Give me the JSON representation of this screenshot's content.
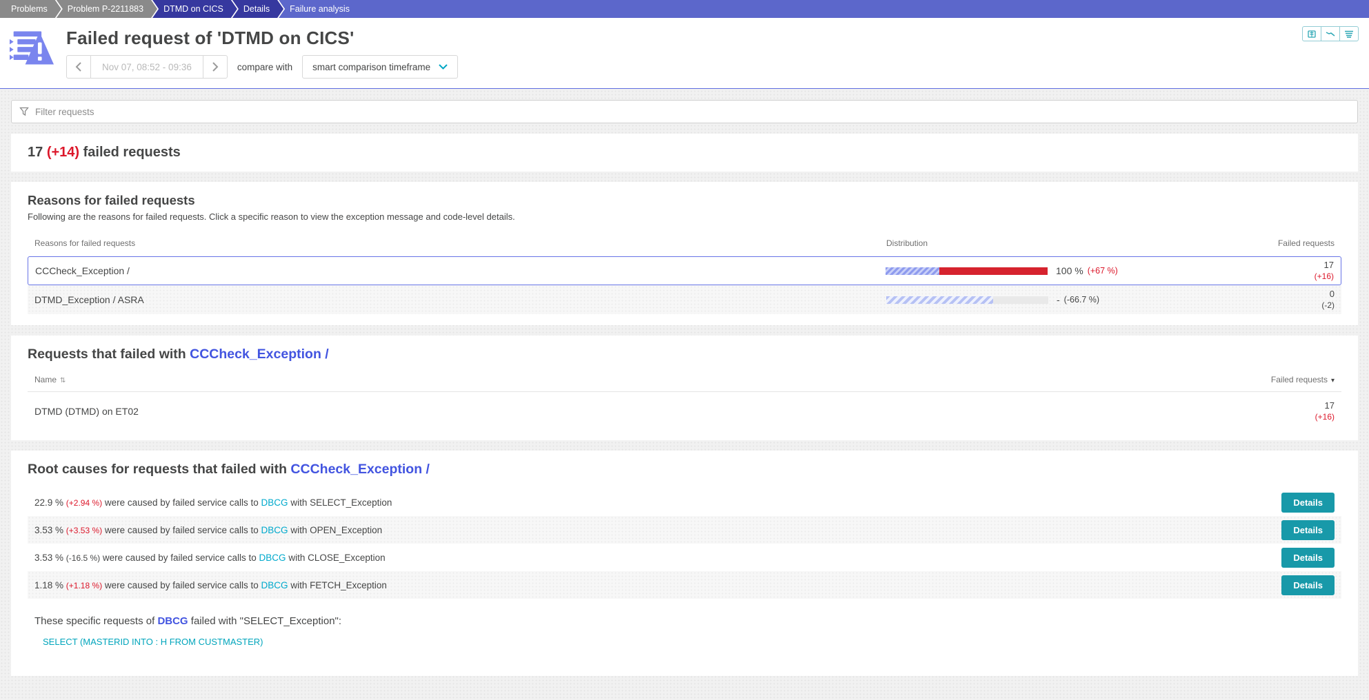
{
  "colors": {
    "accent_teal": "#1899a9",
    "link_cyan": "#00a9cc",
    "link_blue": "#4254e0",
    "alert_red": "#dc172a",
    "bar_red": "#d6232e",
    "bar_blue_striped": "#8e9bee",
    "selected_row_border": "#6673e6",
    "breadcrumb_gray": "#8a8a8a",
    "breadcrumb_dark": "#36389f",
    "breadcrumb_light": "#5c67cb"
  },
  "breadcrumb": {
    "items": [
      {
        "label": "Problems"
      },
      {
        "label": "Problem P-2211883"
      },
      {
        "label": "DTMD on CICS"
      },
      {
        "label": "Details"
      },
      {
        "label": "Failure analysis"
      }
    ]
  },
  "header": {
    "title": "Failed request of 'DTMD on CICS'",
    "timeframe": "Nov 07, 08:52 - 09:36",
    "compare_label": "compare with",
    "compare_value": "smart comparison timeframe"
  },
  "filter": {
    "placeholder": "Filter requests"
  },
  "summary": {
    "count": "17",
    "delta": "(+14)",
    "label": "failed requests"
  },
  "reasons": {
    "title": "Reasons for failed requests",
    "description": "Following are the reasons for failed requests. Click a specific reason to view the exception message and code-level details.",
    "col_reason": "Reasons for failed requests",
    "col_distribution": "Distribution",
    "col_failed": "Failed requests",
    "rows": [
      {
        "reason": "CCCheck_Exception /",
        "percent": "100 %",
        "percent_delta": "(+67 %)",
        "percent_delta_color": "red",
        "failed": "17",
        "failed_delta": "(+16)",
        "failed_delta_color": "red",
        "selected": true,
        "bar_striped_width": "33%",
        "bar_solid_width": "67%"
      },
      {
        "reason": "DTMD_Exception / ASRA",
        "percent": "-",
        "percent_delta": "(-66.7 %)",
        "percent_delta_color": "gray",
        "failed": "0",
        "failed_delta": "(-2)",
        "failed_delta_color": "gray",
        "selected": false,
        "bar_striped_width": "66%",
        "bar_rest_width": "34%"
      }
    ]
  },
  "requests": {
    "title_prefix": "Requests that failed with",
    "title_link": "CCCheck_Exception /",
    "col_name": "Name",
    "col_failed": "Failed requests",
    "sort_name_glyph": "⇅",
    "sort_failed_glyph": "▾",
    "rows": [
      {
        "name": "DTMD (DTMD) on ET02",
        "failed": "17",
        "failed_delta": "(+16)"
      }
    ]
  },
  "root_causes": {
    "title_prefix": "Root causes for requests that failed with",
    "title_link": "CCCheck_Exception /",
    "button_label": "Details",
    "rows": [
      {
        "percent": "22.9 %",
        "delta": "(+2.94 %)",
        "delta_color": "red",
        "text": "were caused by failed service calls to",
        "service": "DBCG",
        "suffix": "with SELECT_Exception"
      },
      {
        "percent": "3.53 %",
        "delta": "(+3.53 %)",
        "delta_color": "red",
        "text": "were caused by failed service calls to",
        "service": "DBCG",
        "suffix": "with OPEN_Exception"
      },
      {
        "percent": "3.53 %",
        "delta": "(-16.5 %)",
        "delta_color": "gray",
        "text": "were caused by failed service calls to",
        "service": "DBCG",
        "suffix": "with CLOSE_Exception"
      },
      {
        "percent": "1.18 %",
        "delta": "(+1.18 %)",
        "delta_color": "red",
        "text": "were caused by failed service calls to",
        "service": "DBCG",
        "suffix": "with FETCH_Exception"
      }
    ],
    "footer_prefix": "These specific requests of",
    "footer_service": "DBCG",
    "footer_suffix": "failed with \"SELECT_Exception\":",
    "query": "SELECT (MASTERID INTO : H FROM CUSTMASTER)"
  }
}
